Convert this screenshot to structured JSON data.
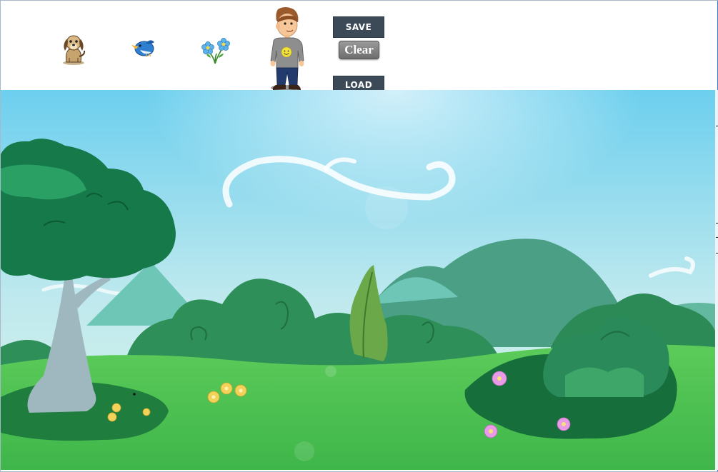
{
  "toolbar": {
    "sprites": [
      {
        "name": "puppy",
        "icon": "dog-icon"
      },
      {
        "name": "bird",
        "icon": "bird-icon"
      },
      {
        "name": "flowers",
        "icon": "flowers-icon"
      },
      {
        "name": "boy",
        "icon": "boy-character-icon"
      }
    ],
    "save_label": "SAVE",
    "clear_label": "Clear",
    "load_label": "LOAD"
  },
  "scene": {
    "description_icon": "meadow-background-icon"
  },
  "colors": {
    "button_dark": "#3b4a56",
    "button_clear": "#7f7f7f",
    "sky_top": "#6fd0ee",
    "grass": "#4dbd4f"
  }
}
